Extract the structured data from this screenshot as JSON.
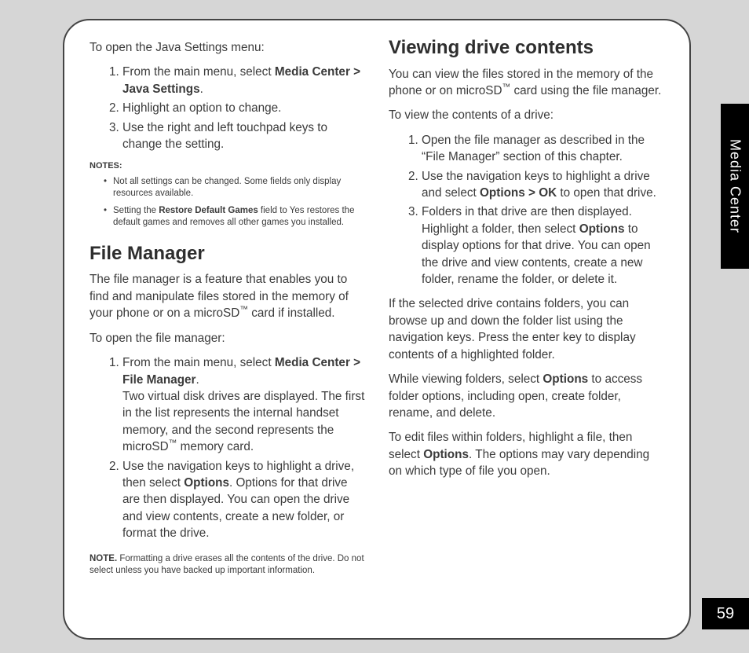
{
  "sideTab": "Media Center",
  "pageNumber": "59",
  "left": {
    "javaIntro": "To open the Java Settings menu:",
    "javaSteps": {
      "s1a": "From the main menu, select ",
      "s1b": "Media Center > Java Settings",
      "s1c": ".",
      "s2": "Highlight an option to change.",
      "s3": "Use the right and left touchpad keys to change the setting."
    },
    "notesLabel": "NOTES:",
    "notes": {
      "n1": "Not all settings can be changed. Some fields only display resources available.",
      "n2a": "Setting the ",
      "n2b": "Restore Default Games",
      "n2c": " field to Yes restores the default games and removes all other games you installed."
    },
    "fmHeading": "File Manager",
    "fmIntroA": "The file manager is a feature that enables you to find and manipulate files stored in the memory of your phone or on a microSD",
    "fmIntroB": " card if installed.",
    "fmOpen": "To open the file manager:",
    "fmSteps": {
      "s1a": "From the main menu, select ",
      "s1b": "Media Center > File Manager",
      "s1c": ".",
      "s1rest": "Two virtual disk drives are displayed. The first in the list represents the internal handset memory, and the second represents the microSD",
      "s1end": " memory card.",
      "s2a": "Use the navigation keys to highlight a drive, then select ",
      "s2b": "Options",
      "s2c": ". Options for that drive are then displayed. You can open the drive and view contents, create a new folder, or format the drive."
    },
    "noteBlockLabel": "NOTE.",
    "noteBlockText": " Formatting a drive erases all the contents of the drive. Do not select unless you have backed up important information."
  },
  "right": {
    "heading": "Viewing drive contents",
    "introA": "You can view the files stored in the memory of the phone or on microSD",
    "introB": " card using the file manager.",
    "viewIntro": "To view the contents of a drive:",
    "steps": {
      "s1": "Open the file manager as described in the “File Manager” section of this chapter.",
      "s2a": "Use the navigation keys to highlight a drive and select ",
      "s2b": "Options > OK",
      "s2c": " to open that drive.",
      "s3a": "Folders in that drive are then displayed. Highlight a folder, then select ",
      "s3b": "Options",
      "s3c": " to display options for that drive. You can open the drive and view contents, create a new folder, rename the folder, or delete it."
    },
    "p1": "If the selected drive contains folders, you can browse up and down the folder list using the navigation keys. Press the enter key to display contents of a highlighted folder.",
    "p2a": "While viewing folders, select ",
    "p2b": "Options",
    "p2c": " to access folder options, including open, create folder, rename, and delete.",
    "p3a": "To edit files within folders, highlight a file, then select ",
    "p3b": "Options",
    "p3c": ". The options may vary depending on which type of file you open."
  }
}
